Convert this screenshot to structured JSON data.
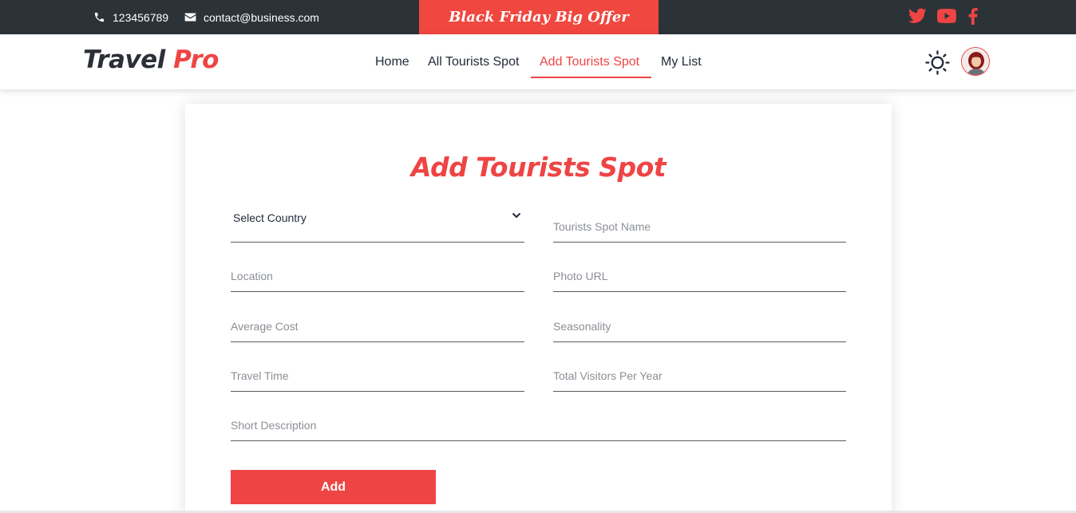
{
  "topbar": {
    "phone": "123456789",
    "email": "contact@business.com",
    "offer": "Black Friday Big Offer",
    "social_icons": [
      "twitter-icon",
      "youtube-icon",
      "facebook-icon"
    ]
  },
  "navbar": {
    "logo_part1": "Travel",
    "logo_part2": "Pro",
    "links": [
      {
        "label": "Home"
      },
      {
        "label": "All Tourists Spot"
      },
      {
        "label": "Add Tourists Spot",
        "active": true
      },
      {
        "label": "My List"
      }
    ],
    "theme_icon": "sun-icon"
  },
  "form": {
    "title": "Add Tourists Spot",
    "country_select": "Select Country",
    "spot_name_placeholder": "Tourists Spot Name",
    "location_placeholder": "Location",
    "photo_url_placeholder": "Photo URL",
    "average_cost_placeholder": "Average Cost",
    "seasonality_placeholder": "Seasonality",
    "travel_time_placeholder": "Travel Time",
    "total_visitors_placeholder": "Total Visitors Per Year",
    "short_description_placeholder": "Short Description",
    "submit_label": "Add"
  },
  "colors": {
    "accent": "#ef4444",
    "topbar_bg": "#2c3338",
    "text_dark": "#1f2937"
  }
}
